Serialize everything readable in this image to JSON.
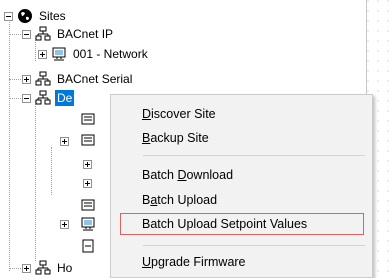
{
  "tree": {
    "root": {
      "label": "Sites",
      "icon": "globe-icon",
      "expanded": true
    },
    "items": [
      {
        "label": "BACnet IP",
        "icon": "network-tree-icon",
        "expanded": true
      },
      {
        "label": "001 - Network",
        "icon": "computer-icon",
        "expanded": false
      },
      {
        "label": "BACnet Serial",
        "icon": "network-tree-icon",
        "expanded": false
      },
      {
        "label": "De",
        "icon": "network-tree-icon",
        "expanded": true,
        "selected": true
      },
      {
        "label": "Ho",
        "icon": "network-tree-icon",
        "expanded": false
      }
    ]
  },
  "context_menu": {
    "items": [
      {
        "pre": "",
        "accel": "D",
        "post": "iscover Site"
      },
      {
        "pre": "",
        "accel": "B",
        "post": "ackup Site"
      },
      {
        "pre": "Batch ",
        "accel": "D",
        "post": "ownload"
      },
      {
        "pre": "B",
        "accel": "a",
        "post": "tch Upload"
      },
      {
        "pre": "Batch Upload Setpoint Values",
        "accel": "",
        "post": "",
        "highlighted": true
      },
      {
        "pre": "",
        "accel": "U",
        "post": "pgrade Firmware"
      }
    ]
  },
  "colors": {
    "selection": "#0078d7",
    "highlight_border": "#e06060",
    "menu_background": "#f2f2f2"
  }
}
